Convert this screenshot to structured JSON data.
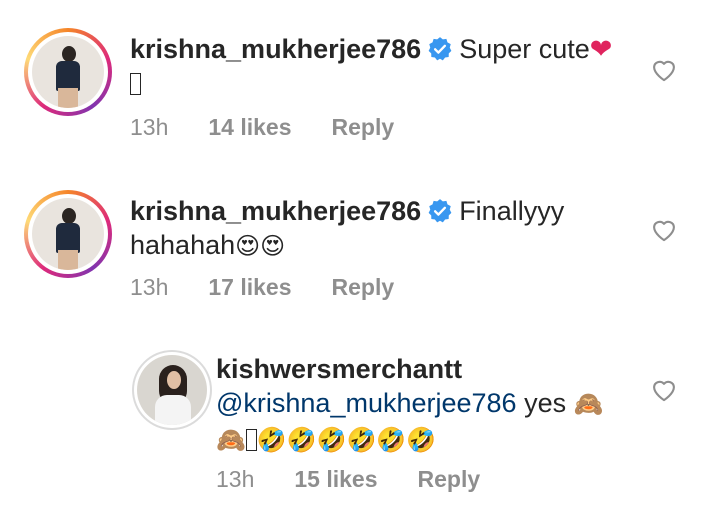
{
  "comments": [
    {
      "username": "krishna_mukherjee786",
      "text_line1": "Super cute",
      "heart_emoji": "❤",
      "time": "13h",
      "likes": "14 likes",
      "reply": "Reply"
    },
    {
      "username": "krishna_mukherjee786",
      "text_line1": "Finallyyy",
      "text_line2": "hahahah",
      "emojis": "😍😍",
      "time": "13h",
      "likes": "17 likes",
      "reply": "Reply"
    },
    {
      "username": "kishwersmerchantt",
      "mention": "@krishna_mukherjee786",
      "text_after_mention": "yes",
      "emoji_monkey": "🙈",
      "emoji_line2_start": "🙈",
      "emoji_laugh": "🤣🤣🤣🤣🤣🤣",
      "time": "13h",
      "likes": "15 likes",
      "reply": "Reply"
    }
  ],
  "icons": {
    "verified": "verified-badge-icon",
    "like": "heart-outline-icon"
  },
  "colors": {
    "verified_blue": "#3897f0",
    "mention_blue": "#00376b",
    "meta_gray": "#8e8e8e"
  }
}
